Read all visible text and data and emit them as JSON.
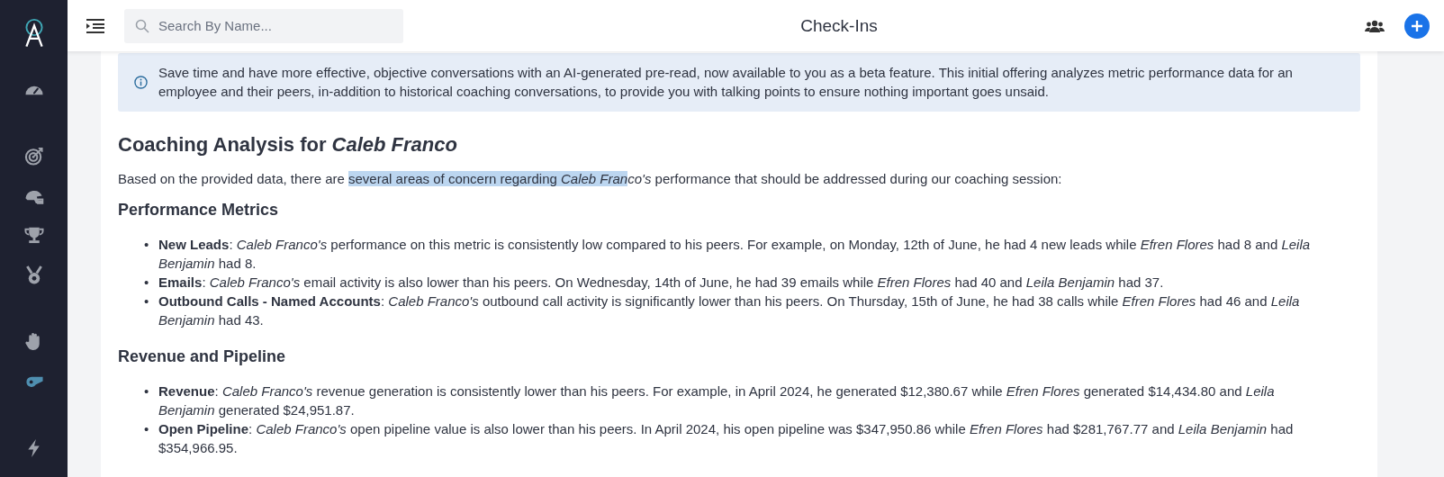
{
  "sidebar": {
    "items": [
      {
        "kind": "gauge",
        "selected": false
      },
      {
        "kind": "target",
        "selected": false
      },
      {
        "kind": "helmet",
        "selected": false
      },
      {
        "kind": "trophy",
        "selected": false
      },
      {
        "kind": "medal",
        "selected": false
      },
      {
        "kind": "hand",
        "selected": false
      },
      {
        "kind": "whistle",
        "selected": true
      },
      {
        "kind": "bolt",
        "selected": false
      }
    ]
  },
  "header": {
    "search": {
      "placeholder": "Search By Name..."
    },
    "title": "Check-Ins"
  },
  "banner": {
    "text": "Save time and have more effective, objective conversations with an AI-generated pre-read, now available to you as a beta feature. This initial offering analyzes metric performance data for an employee and their peers, in-addition to historical coaching conversations, to provide you with talking points to ensure nothing important goes unsaid."
  },
  "analysis": {
    "title": "Coaching Analysis for *Caleb Franco*",
    "intro": [
      {
        "text": "Based on the provided data, there are ",
        "highlighted": false
      },
      {
        "text": "several areas of concern regarding *Caleb Fran*",
        "highlighted": true
      },
      {
        "text": "*co's* performance that should be addressed during our coaching session:",
        "highlighted": false
      }
    ],
    "sections": [
      {
        "heading": "Performance Metrics",
        "items": [
          {
            "bullet": "•",
            "text": "**New Leads**: *Caleb Franco's* performance on this metric is consistently low compared to his peers. For example, on Monday, 12th of June, he had 4 new leads while *Efren Flores* had 8 and *Leila Benjamin* had 8."
          },
          {
            "bullet": "•",
            "text": "**Emails**: *Caleb Franco's* email activity is also lower than his peers. On Wednesday, 14th of June, he had 39 emails while *Efren Flores* had 40 and *Leila Benjamin* had 37."
          },
          {
            "bullet": "•",
            "text": "**Outbound Calls - Named Accounts**: *Caleb Franco's* outbound call activity is significantly lower than his peers. On Thursday, 15th of June, he had 38 calls while *Efren Flores* had 46 and *Leila Benjamin* had 43."
          }
        ]
      },
      {
        "heading": "Revenue and Pipeline",
        "items": [
          {
            "bullet": "•",
            "text": "**Revenue**: *Caleb Franco's* revenue generation is consistently lower than his peers. For example, in April 2024, he generated $12,380.67 while *Efren Flores* generated $14,434.80 and *Leila Benjamin* generated $24,951.87."
          },
          {
            "bullet": "•",
            "text": "**Open Pipeline**: *Caleb Franco's* open pipeline value is also lower than his peers. In April 2024, his open pipeline was $347,950.86 while *Efren Flores* had $281,767.77 and *Leila Benjamin* had $354,966.95."
          }
        ]
      }
    ]
  }
}
